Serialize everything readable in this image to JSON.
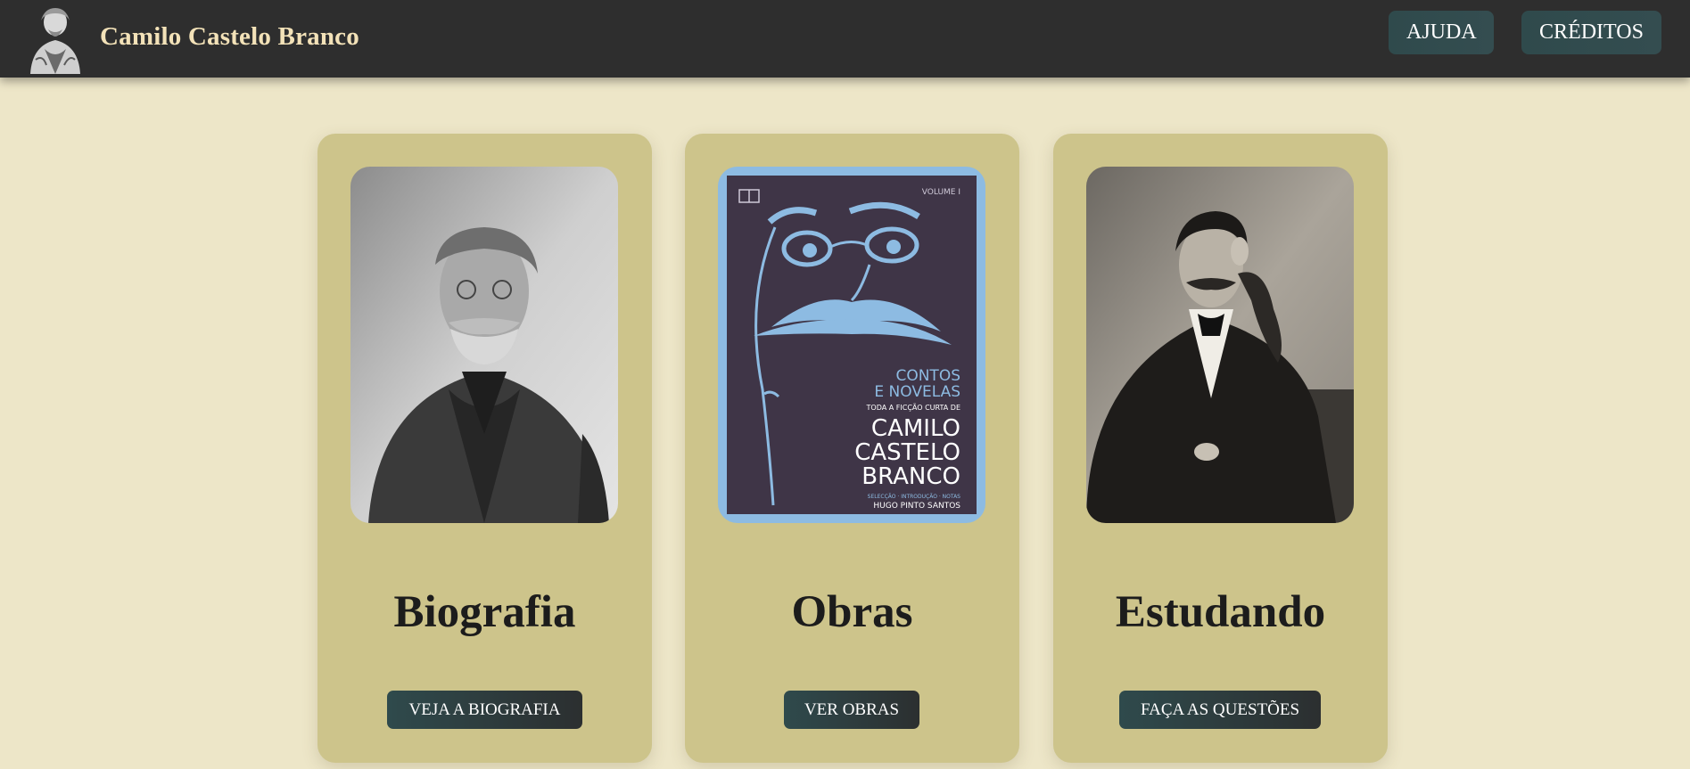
{
  "header": {
    "brand": "Camilo Castelo Branco",
    "logo_icon": "author-portrait-icon",
    "nav": [
      {
        "label": "AJUDA"
      },
      {
        "label": "CRÉDITOS"
      }
    ]
  },
  "cards": [
    {
      "title": "Biografia",
      "button": "VEJA A BIOGRAFIA",
      "image": "author-seated-elderly-photo"
    },
    {
      "title": "Obras",
      "button": "VER OBRAS",
      "image": "book-cover",
      "cover": {
        "volume": "VOLUME I",
        "line1": "CONTOS",
        "line2": "E NOVELAS",
        "subtitle": "TODA A FICÇÃO CURTA DE",
        "author1": "CAMILO",
        "author2": "CASTELO",
        "author3": "BRANCO",
        "credits": "SELECÇÃO · INTRODUÇÃO · NOTAS",
        "editor": "HUGO PINTO SANTOS"
      }
    },
    {
      "title": "Estudando",
      "button": "FAÇA AS QUESTÕES",
      "image": "author-young-portrait-photo"
    }
  ],
  "colors": {
    "background": "#ede6c8",
    "topbar": "#2e2e2e",
    "card": "#cdc48b",
    "button": "#2f4a4c",
    "brand_text": "#f3e2b8",
    "cover_bg": "#3f3547",
    "cover_frame": "#8dbbe2"
  }
}
